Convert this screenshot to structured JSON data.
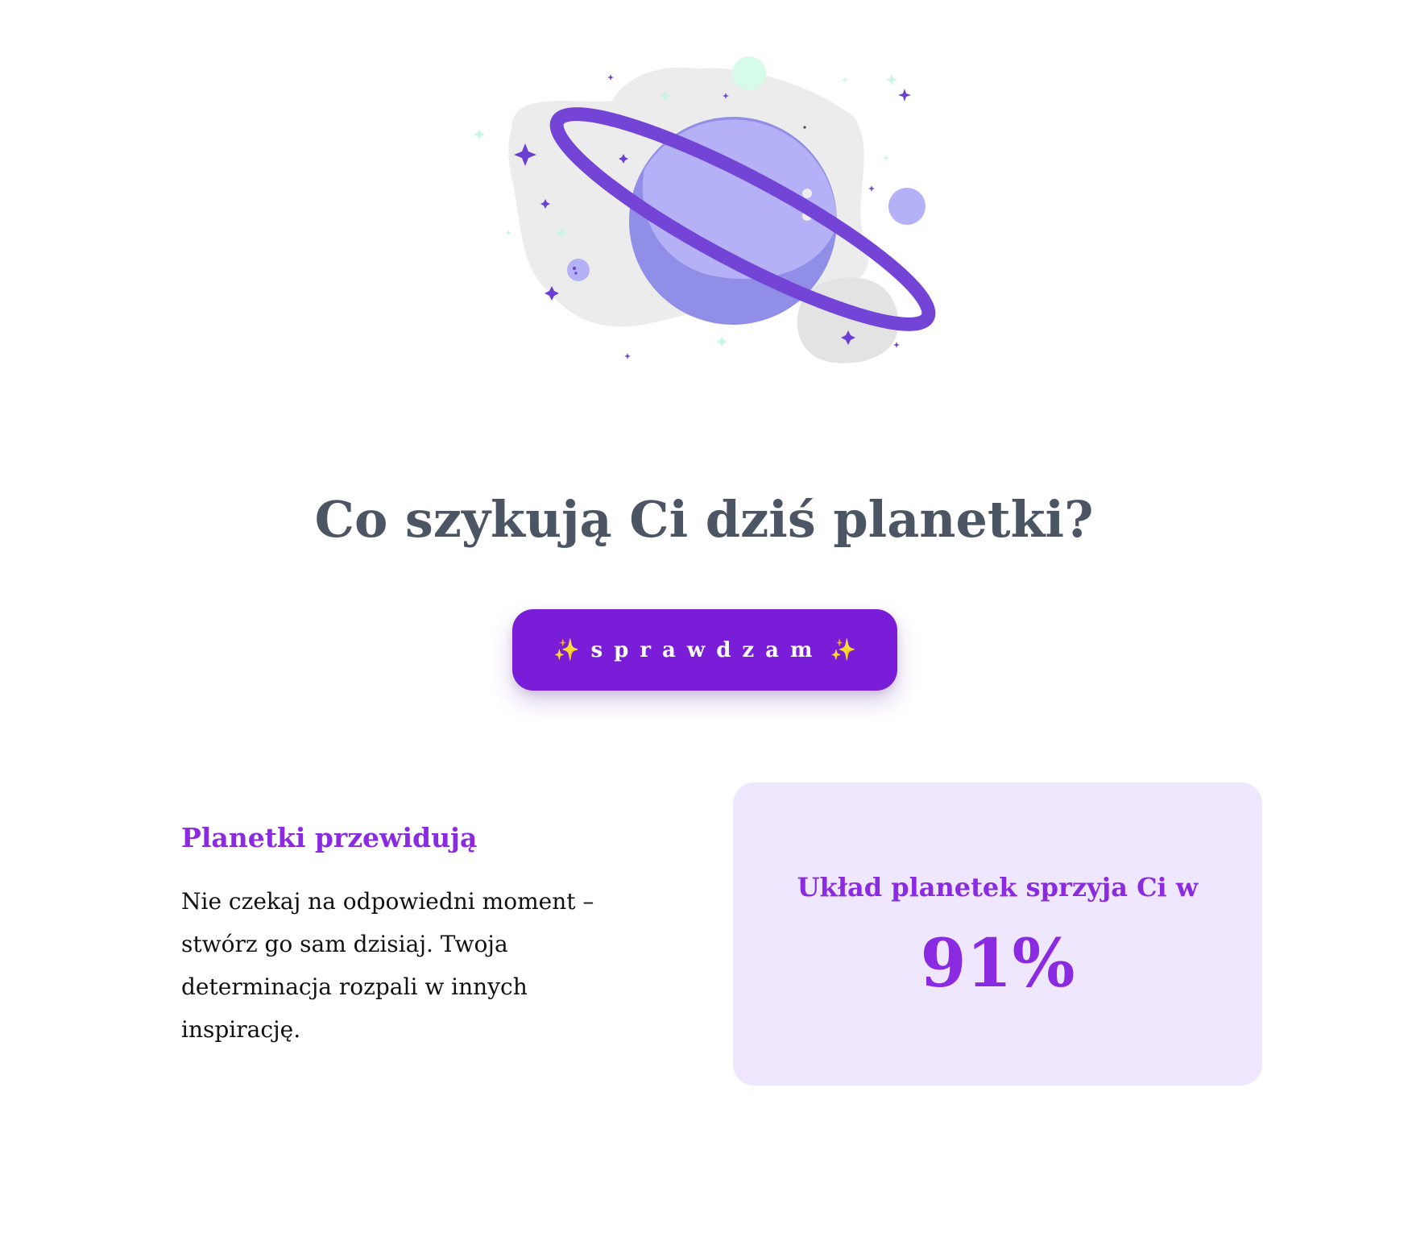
{
  "hero": {
    "illustration": "planet-with-ring-icon",
    "colors": {
      "planet": "#b4b1f7",
      "planet_shadow": "#918ee8",
      "ring": "#7444d6",
      "blob": "#ececec",
      "star": "#6a3fd1",
      "accent_mint": "#d6fbe9"
    }
  },
  "title": "Co szykują Ci dziś planetki?",
  "cta": {
    "spark_left": "✨",
    "label": "sprawdzam",
    "spark_right": "✨",
    "color": "#7a1dd9"
  },
  "prediction": {
    "heading": "Planetki przewidują",
    "text": "Nie czekaj na odpowiedni moment – stwórz go sam dzisiaj. Twoja determinacja rozpali w innych inspirację."
  },
  "score": {
    "label": "Układ planetek sprzyja Ci w",
    "value": "91%",
    "accent": "#8a2be2",
    "card_bg": "#efe7fd"
  }
}
